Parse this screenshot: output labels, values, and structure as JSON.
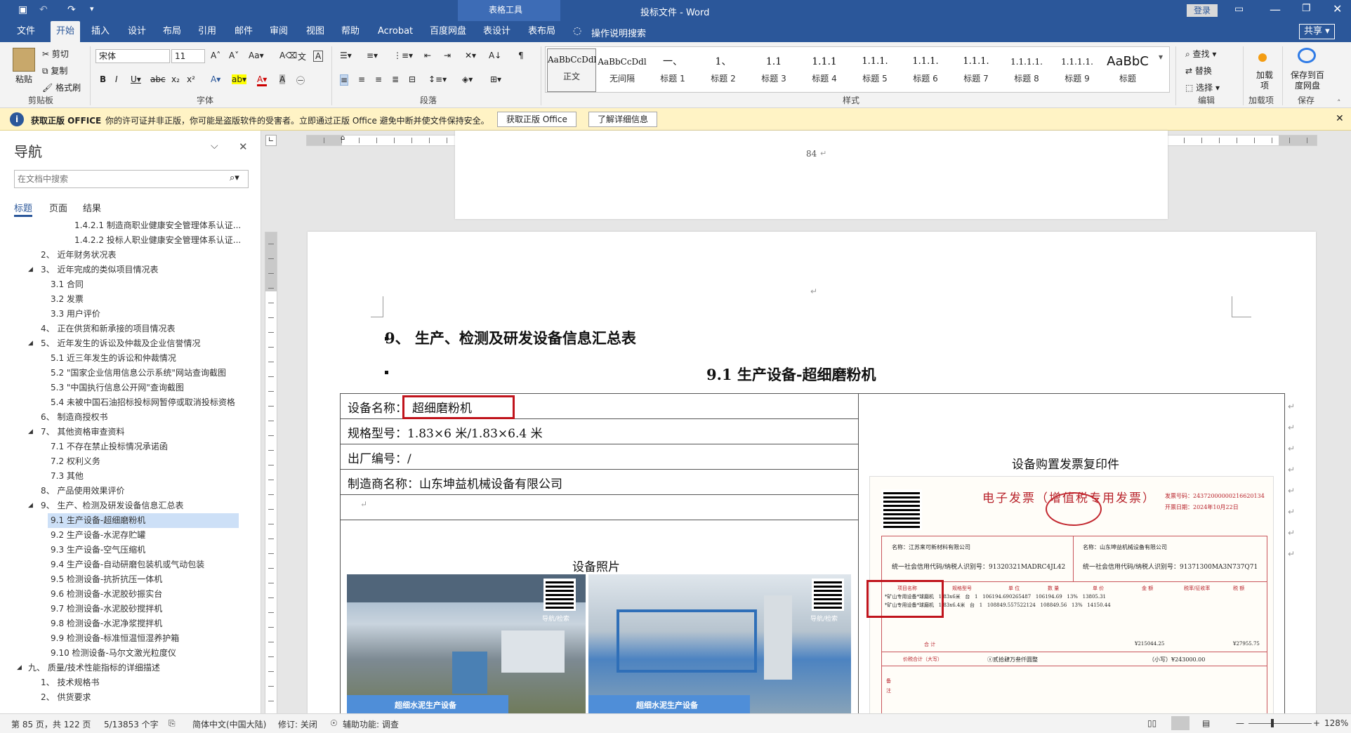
{
  "titlebar": {
    "context_tab": "表格工具",
    "title": "投标文件  -  Word",
    "login": "登录"
  },
  "tabs": [
    "文件",
    "开始",
    "插入",
    "设计",
    "布局",
    "引用",
    "邮件",
    "审阅",
    "视图",
    "帮助",
    "Acrobat",
    "百度网盘",
    "表设计",
    "表布局"
  ],
  "tell_me": "操作说明搜索",
  "share": "共享",
  "ribbon": {
    "clipboard": {
      "paste": "粘贴",
      "cut": "剪切",
      "copy": "复制",
      "format_painter": "格式刷",
      "label": "剪贴板"
    },
    "font": {
      "name": "宋体",
      "size": "11",
      "label": "字体"
    },
    "paragraph": {
      "label": "段落"
    },
    "styles": {
      "label": "样式",
      "items": [
        {
          "sample": "AaBbCcDdl",
          "name": "正文"
        },
        {
          "sample": "AaBbCcDdl",
          "name": "无间隔"
        },
        {
          "sample": "一、",
          "name": "标题 1"
        },
        {
          "sample": "1、",
          "name": "标题 2"
        },
        {
          "sample": "1.1",
          "name": "标题 3"
        },
        {
          "sample": "1.1.1",
          "name": "标题 4"
        },
        {
          "sample": "1.1.1.",
          "name": "标题 5"
        },
        {
          "sample": "1.1.1.",
          "name": "标题 6"
        },
        {
          "sample": "1.1.1.",
          "name": "标题 7"
        },
        {
          "sample": "1.1.1.1.",
          "name": "标题 8"
        },
        {
          "sample": "1.1.1.1.",
          "name": "标题 9"
        },
        {
          "sample": "AaBbC",
          "name": "标题"
        }
      ]
    },
    "editing": {
      "find": "查找",
      "replace": "替换",
      "select": "选择",
      "label": "编辑"
    },
    "addins": {
      "btn": "加载项",
      "label": "加载项"
    },
    "save": {
      "btn": "保存到百度网盘",
      "label": "保存"
    }
  },
  "message_bar": {
    "title": "获取正版 OFFICE",
    "text": "你的许可证并非正版，你可能是盗版软件的受害者。立即通过正版 Office 避免中断并使文件保持安全。",
    "btn1": "获取正版 Office",
    "btn2": "了解详细信息"
  },
  "nav": {
    "title": "导航",
    "search_placeholder": "在文档中搜索",
    "tabs": [
      "标题",
      "页面",
      "结果"
    ],
    "items": [
      "1.4.2.1 制造商职业健康安全管理体系认证...",
      "1.4.2.2 投标人职业健康安全管理体系认证...",
      "2、 近年财务状况表",
      "3、 近年完成的类似项目情况表",
      "3.1 合同",
      "3.2 发票",
      "3.3 用户评价",
      "4、 正在供货和新承接的项目情况表",
      "5、 近年发生的诉讼及仲裁及企业信誉情况",
      "5.1 近三年发生的诉讼和仲裁情况",
      "5.2 \"国家企业信用信息公示系统\"网站查询截图",
      "5.3 \"中国执行信息公开网\"查询截图",
      "5.4 未被中国石油招标投标网暂停或取消投标资格",
      "6、 制造商授权书",
      "7、 其他资格审查资料",
      "7.1 不存在禁止投标情况承诺函",
      "7.2 权利义务",
      "7.3 其他",
      "8、 产品使用效果评价",
      "9、 生产、检测及研发设备信息汇总表",
      "9.1 生产设备-超细磨粉机",
      "9.2 生产设备-水泥存贮罐",
      "9.3 生产设备-空气压缩机",
      "9.4 生产设备-自动研磨包装机或气动包装",
      "9.5 检测设备-抗折抗压一体机",
      "9.6 检测设备-水泥胶砂振实台",
      "9.7 检测设备-水泥胶砂搅拌机",
      "9.8 检测设备-水泥净浆搅拌机",
      "9.9 检测设备-标准恒温恒湿养护箱",
      "9.10 检测设备-马尔文激光粒度仪",
      "九、 质量/技术性能指标的详细描述",
      "1、 技术规格书",
      "2、 供货要求"
    ]
  },
  "document": {
    "page_number": "84",
    "heading1": "9、     生产、检测及研发设备信息汇总表",
    "heading2": "9.1     生产设备-超细磨粉机",
    "table": {
      "row1_label": "设备名称：",
      "row1_value": "超细磨粉机",
      "row2": "规格型号：1.83×6 米/1.83×6.4 米",
      "row3": "出厂编号：/",
      "row4": "制造商名称：山东坤益机械设备有限公司",
      "photo_caption": "设备照片",
      "photo_banner": "超细水泥生产设备",
      "qr_label": "导航/检索",
      "invoice_caption": "设备购置发票复印件"
    },
    "invoice": {
      "title": "电子发票（增值税专用发票）",
      "number_label": "发票号码：24372000000216620134",
      "date_label": "开票日期：2024年10月22日",
      "buyer": "名称：江苏来可新材料有限公司",
      "buyer_code": "统一社会信用代码/纳税人识别号：91320321MADRC4JL42",
      "seller": "名称：山东坤益机械设备有限公司",
      "seller_code": "统一社会信用代码/纳税人识别号：91371300MA3N737Q71",
      "col_name": "项目名称",
      "col_spec": "规格型号",
      "col_unit": "单 位",
      "col_qty": "数 量",
      "col_price": "单 价",
      "col_amount": "金 额",
      "col_rate": "税率/征收率",
      "col_tax": "税 额",
      "line1": "*矿山专用设备*球磨机   1.83x6米   台   1   106194.690265487   106194.69   13%   13805.31",
      "line2": "*矿山专用设备*球磨机   1.83x6.4米   台   1   108849.557522124   108849.56   13%   14150.44",
      "total_label": "合 计",
      "total_amount": "¥215044.25",
      "total_tax": "¥27955.75",
      "grand_label": "价税合计（大写）",
      "grand_upper": "ⓧ贰拾肆万叁仟圆整",
      "grand_lower": "（小写）¥243000.00",
      "remark": "备注"
    }
  },
  "status": {
    "page": "第 85 页，共 122 页",
    "words": "5/13853 个字",
    "lang": "简体中文(中国大陆)",
    "track": "修订: 关闭",
    "access": "辅助功能: 调查",
    "zoom": "128%"
  }
}
